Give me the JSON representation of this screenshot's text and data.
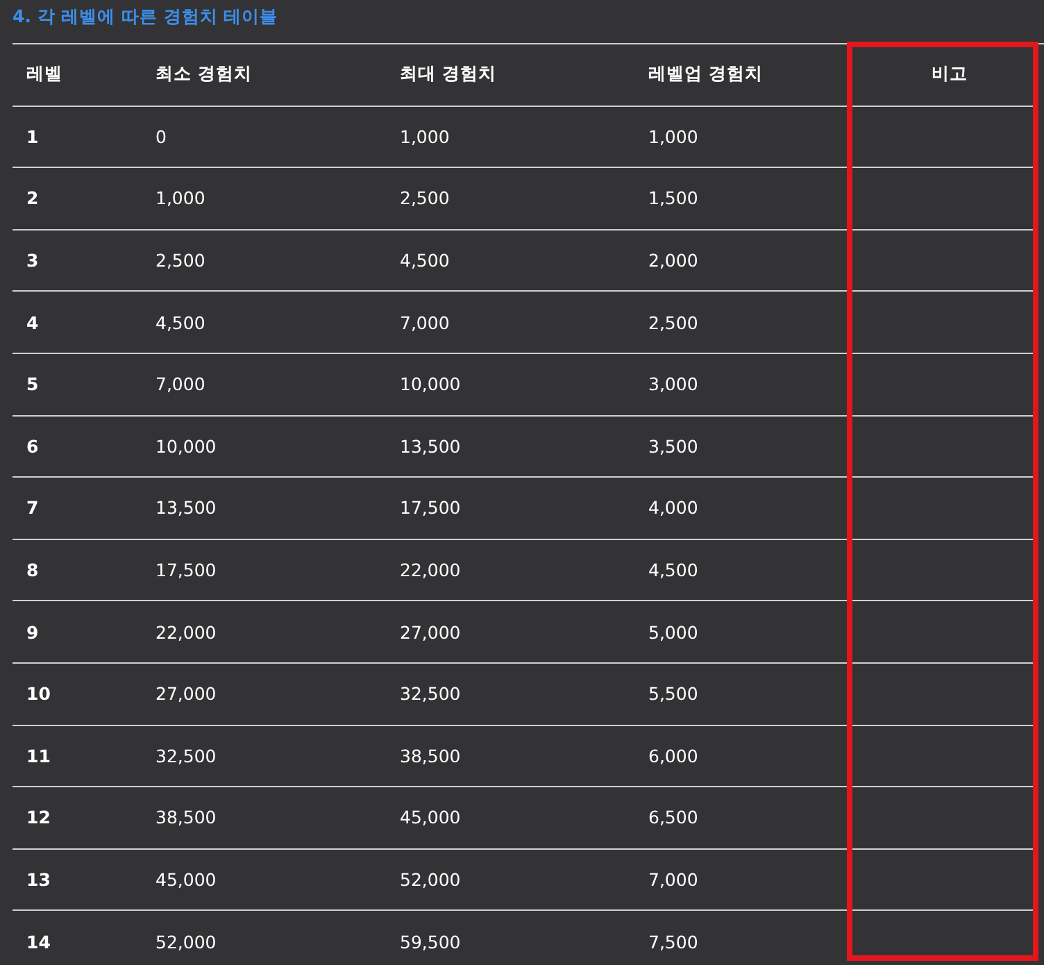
{
  "title": "4. 각 레벨에 따른 경험치 테이블",
  "table": {
    "columns": [
      {
        "label": "레벨",
        "highlighted": false
      },
      {
        "label": "최소 경험치",
        "highlighted": false
      },
      {
        "label": "최대 경험치",
        "highlighted": false
      },
      {
        "label": "레벨업 경험치",
        "highlighted": false
      },
      {
        "label": "비고",
        "highlighted": true
      }
    ],
    "rows": [
      [
        "1",
        "0",
        "1,000",
        "1,000"
      ],
      [
        "2",
        "1,000",
        "2,500",
        "1,500"
      ],
      [
        "3",
        "2,500",
        "4,500",
        "2,000"
      ],
      [
        "4",
        "4,500",
        "7,000",
        "2,500"
      ],
      [
        "5",
        "7,000",
        "10,000",
        "3,000"
      ],
      [
        "6",
        "10,000",
        "13,500",
        "3,500"
      ],
      [
        "7",
        "13,500",
        "17,500",
        "4,000"
      ],
      [
        "8",
        "17,500",
        "22,000",
        "4,500"
      ],
      [
        "9",
        "22,000",
        "27,000",
        "5,000"
      ],
      [
        "10",
        "27,000",
        "32,500",
        "5,500"
      ],
      [
        "11",
        "32,500",
        "38,500",
        "6,000"
      ],
      [
        "12",
        "38,500",
        "45,000",
        "6,500"
      ],
      [
        "13",
        "45,000",
        "52,000",
        "7,000"
      ],
      [
        "14",
        "52,000",
        "59,500",
        "7,500"
      ]
    ]
  }
}
